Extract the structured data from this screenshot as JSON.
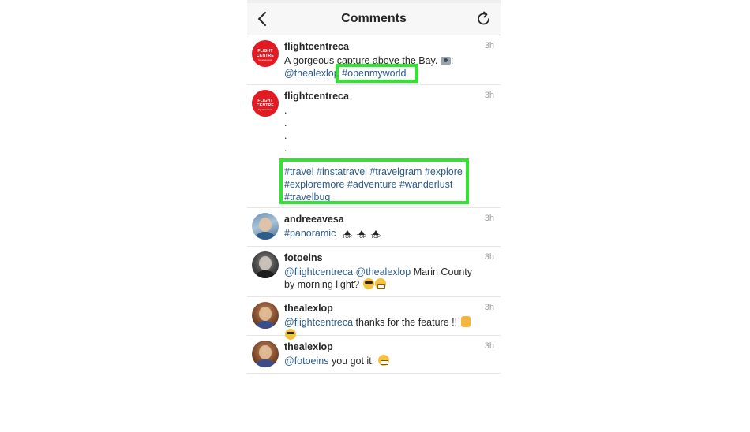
{
  "header": {
    "title": "Comments",
    "back_icon": "chevron-left-icon",
    "refresh_icon": "refresh-icon"
  },
  "colors": {
    "link": "#2b5b8a",
    "highlight": "#32e332",
    "brand_red": "#e21b23"
  },
  "comments": [
    {
      "username": "flightcentreca",
      "avatar_text": [
        "FLIGHT",
        "CENTRE",
        "by adventure"
      ],
      "text_prefix": "A gorgeous capture above the Bay. ",
      "text_suffix": ":",
      "mention": "@thealexlop",
      "hashtag": "#openmyworld",
      "time": "3h"
    },
    {
      "username": "flightcentreca",
      "avatar_text": [
        "FLIGHT",
        "CENTRE",
        "by adventure"
      ],
      "dots": [
        ".",
        ".",
        ".",
        "."
      ],
      "hashtags": [
        "#travel",
        "#instatravel",
        "#travelgram",
        "#explore",
        "#exploremore",
        "#adventure",
        "#wanderlust",
        "#travelbug"
      ],
      "time": "3h"
    },
    {
      "username": "andreeavesa",
      "hashtag": "#panoramic",
      "top_label": "TOP",
      "time": "3h"
    },
    {
      "username": "fotoeins",
      "mentions": [
        "@flightcentreca",
        "@thealexlop"
      ],
      "text": " Marin County by morning light? ",
      "time": "3h"
    },
    {
      "username": "thealexlop",
      "mention": "@flightcentreca",
      "text": " thanks for the feature !! ",
      "time": "3h"
    },
    {
      "username": "thealexlop",
      "mention": "@fotoeins",
      "text": " you got it. ",
      "time": "3h"
    }
  ]
}
